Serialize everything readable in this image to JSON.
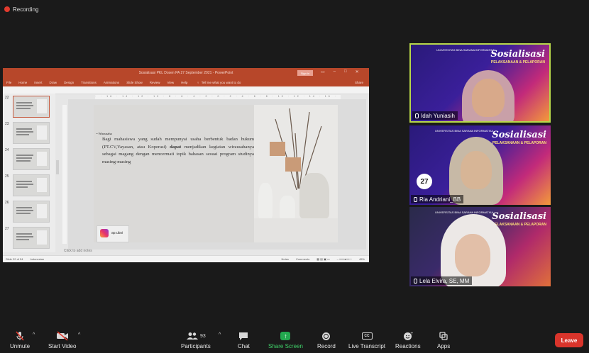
{
  "recording": {
    "label": "Recording",
    "color": "#e23b2e"
  },
  "powerpoint": {
    "window_title": "Sosialisasi PKL Dosen PA 27 September 2021 - PowerPoint",
    "sign_in": "Sign in",
    "tabs": [
      "File",
      "Home",
      "Insert",
      "Draw",
      "Design",
      "Transitions",
      "Animations",
      "Slide Show",
      "Review",
      "View",
      "Help"
    ],
    "tell_me": "Tell me what you want to do",
    "share": "Share",
    "thumbnail_numbers": [
      "22",
      "23",
      "24",
      "25",
      "26",
      "27"
    ],
    "selected_thumbnail": "22",
    "slide": {
      "bullet": "• Wirausaha",
      "body_before_bold": "Bagi mahasiswa yang sudah mempunyai usaha berbentuk badan hukum (PT.CV,Yayasan, atau Koperasi) ",
      "body_bold": "dapat",
      "body_after_bold": " menjadikan kegiatan wirausahanya sebagai magang dengan mencermati topik bahasan sesuai program studinya masing-masing",
      "instagram_handle": "ap.ubsi"
    },
    "notes_placeholder": "Click to add notes",
    "status_slide": "Slide 22 of 54",
    "status_language": "Indonesian",
    "status_notes": "Notes",
    "status_comments": "Comments",
    "zoom": "45%",
    "accent": "#b7472a"
  },
  "participants": [
    {
      "name": "Idah Yuniasih",
      "active_speaker": true,
      "speaker_border": "#b8d84a"
    },
    {
      "name": "Ria Andriani_BB",
      "active_speaker": false
    },
    {
      "name": "Lela Elvira, SE, MM",
      "active_speaker": false
    }
  ],
  "banner": {
    "title": "Sosialisasi",
    "subtitle": "PELAKSANAAN & PELAPORAN",
    "university": "UNIVERSITAS BINA SARANA INFORMATIKA",
    "date_badge": "27"
  },
  "toolbar": {
    "unmute": "Unmute",
    "start_video": "Start Video",
    "participants": "Participants",
    "participants_count": "93",
    "chat": "Chat",
    "share_screen": "Share Screen",
    "record": "Record",
    "live_transcript": "Live Transcript",
    "cc": "CC",
    "reactions": "Reactions",
    "apps": "Apps",
    "leave": "Leave",
    "share_color": "#23a84f",
    "leave_color": "#d9342b"
  }
}
